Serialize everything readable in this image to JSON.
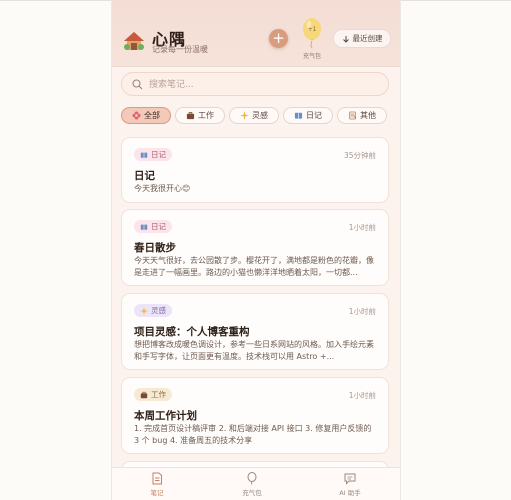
{
  "app": {
    "title": "心隅",
    "subtitle": "记录每一份温暖"
  },
  "header": {
    "add_label": "+",
    "balloon_label": "充气包",
    "sort_label": "最近创建"
  },
  "search": {
    "placeholder": "搜索笔记..."
  },
  "filters": [
    {
      "label": "全部",
      "icon": "flower-icon",
      "active": true
    },
    {
      "label": "工作",
      "icon": "briefcase-icon",
      "active": false
    },
    {
      "label": "灵感",
      "icon": "sparkle-icon",
      "active": false
    },
    {
      "label": "日记",
      "icon": "book-icon",
      "active": false
    },
    {
      "label": "其他",
      "icon": "memo-icon",
      "active": false
    }
  ],
  "notes": [
    {
      "tag": "日记",
      "tag_icon": "book-icon",
      "time": "35分钟前",
      "title": "日记",
      "body": "今天我很开心😊"
    },
    {
      "tag": "日记",
      "tag_icon": "book-icon",
      "time": "1小时前",
      "title": "春日散步",
      "body": "今天天气很好，去公园散了步。樱花开了，满地都是粉色的花瓣，像是走进了一幅画里。路边的小猫也懒洋洋地晒着太阳，一切都..."
    },
    {
      "tag": "灵感",
      "tag_icon": "sparkle-icon",
      "time": "1小时前",
      "title": "项目灵感：个人博客重构",
      "body": "想把博客改成暖色调设计，参考一些日系网站的风格。加入手绘元素和手写字体，让页面更有温度。技术栈可以用 Astro +..."
    },
    {
      "tag": "工作",
      "tag_icon": "briefcase-icon",
      "time": "1小时前",
      "title": "本周工作计划",
      "body": "1. 完成首页设计稿评审 2. 和后端对接 API 接口 3. 修复用户反馈的 3 个 bug 4. 准备周五的技术分享"
    }
  ],
  "nav": [
    {
      "label": "笔记",
      "icon": "note-icon",
      "active": true
    },
    {
      "label": "充气包",
      "icon": "balloon-icon",
      "active": false
    },
    {
      "label": "AI 助手",
      "icon": "chat-icon",
      "active": false
    }
  ],
  "colors": {
    "accent": "#d99c7f",
    "header_bg": "#f3ddd5",
    "active_chip": "#f3c9b9"
  }
}
